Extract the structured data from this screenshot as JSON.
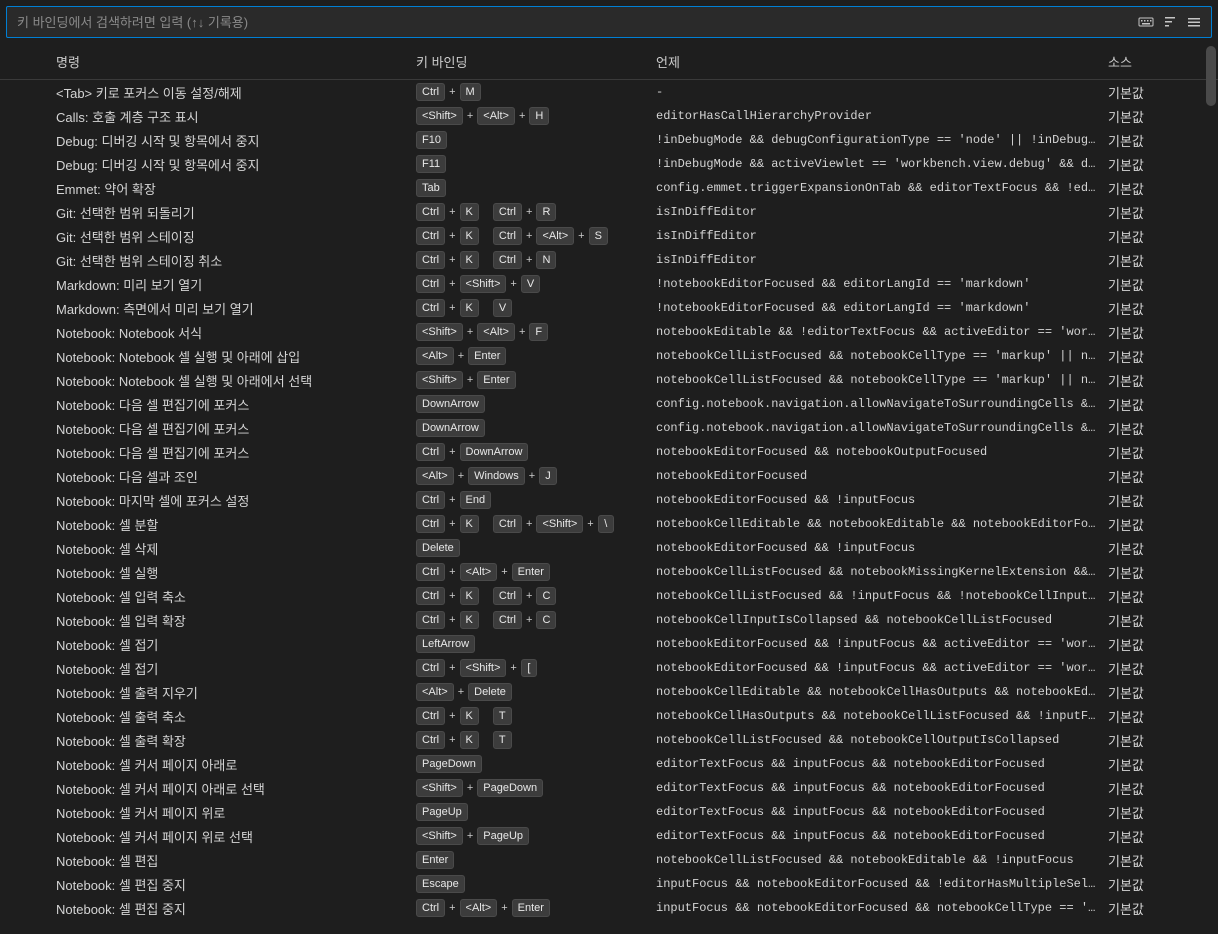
{
  "search": {
    "placeholder": "키 바인딩에서 검색하려면 입력 (↑↓ 기록용)"
  },
  "icons": {
    "keyboard": "keyboard-icon",
    "sort": "sort-icon",
    "filter": "filter-icon"
  },
  "headers": {
    "command": "명령",
    "binding": "키 바인딩",
    "when": "언제",
    "source": "소스"
  },
  "default_source": "기본값",
  "rows": [
    {
      "command": "<Tab> 키로 포커스 이동 설정/해제",
      "keys": [
        [
          "Ctrl",
          "M"
        ]
      ],
      "when": "-",
      "source": "기본값"
    },
    {
      "command": "Calls: 호출 계층 구조 표시",
      "keys": [
        [
          "<Shift>",
          "<Alt>",
          "H"
        ]
      ],
      "when": "editorHasCallHierarchyProvider",
      "source": "기본값"
    },
    {
      "command": "Debug: 디버깅 시작 및 항목에서 중지",
      "keys": [
        [
          "F10"
        ]
      ],
      "when": "!inDebugMode && debugConfigurationType == 'node' || !inDebugMode ...",
      "source": "기본값"
    },
    {
      "command": "Debug: 디버깅 시작 및 항목에서 중지",
      "keys": [
        [
          "F11"
        ]
      ],
      "when": "!inDebugMode && activeViewlet == 'workbench.view.debug' && debugC...",
      "source": "기본값"
    },
    {
      "command": "Emmet: 약어 확장",
      "keys": [
        [
          "Tab"
        ]
      ],
      "when": "config.emmet.triggerExpansionOnTab && editorTextFocus && !editorR...",
      "source": "기본값"
    },
    {
      "command": "Git: 선택한 범위 되돌리기",
      "keys": [
        [
          "Ctrl",
          "K"
        ],
        [
          "Ctrl",
          "R"
        ]
      ],
      "when": "isInDiffEditor",
      "source": "기본값"
    },
    {
      "command": "Git: 선택한 범위 스테이징",
      "keys": [
        [
          "Ctrl",
          "K"
        ],
        [
          "Ctrl",
          "<Alt>",
          "S"
        ]
      ],
      "when": "isInDiffEditor",
      "source": "기본값"
    },
    {
      "command": "Git: 선택한 범위 스테이징 취소",
      "keys": [
        [
          "Ctrl",
          "K"
        ],
        [
          "Ctrl",
          "N"
        ]
      ],
      "when": "isInDiffEditor",
      "source": "기본값"
    },
    {
      "command": "Markdown: 미리 보기 열기",
      "keys": [
        [
          "Ctrl",
          "<Shift>",
          "V"
        ]
      ],
      "when": "!notebookEditorFocused && editorLangId == 'markdown'",
      "source": "기본값"
    },
    {
      "command": "Markdown: 측면에서 미리 보기 열기",
      "keys": [
        [
          "Ctrl",
          "K"
        ],
        [
          "V"
        ]
      ],
      "when": "!notebookEditorFocused && editorLangId == 'markdown'",
      "source": "기본값"
    },
    {
      "command": "Notebook: Notebook 서식",
      "keys": [
        [
          "<Shift>",
          "<Alt>",
          "F"
        ]
      ],
      "when": "notebookEditable && !editorTextFocus && activeEditor == 'workbenc...",
      "source": "기본값"
    },
    {
      "command": "Notebook: Notebook 셀 실행 및 아래에 삽입",
      "keys": [
        [
          "<Alt>",
          "Enter"
        ]
      ],
      "when": "notebookCellListFocused && notebookCellType == 'markup' || notebo...",
      "source": "기본값"
    },
    {
      "command": "Notebook: Notebook 셀 실행 및 아래에서 선택",
      "keys": [
        [
          "<Shift>",
          "Enter"
        ]
      ],
      "when": "notebookCellListFocused && notebookCellType == 'markup' || notebo...",
      "source": "기본값"
    },
    {
      "command": "Notebook: 다음 셀 편집기에 포커스",
      "keys": [
        [
          "DownArrow"
        ]
      ],
      "when": "config.notebook.navigation.allowNavigateToSurroundingCells && edi...",
      "source": "기본값"
    },
    {
      "command": "Notebook: 다음 셀 편집기에 포커스",
      "keys": [
        [
          "DownArrow"
        ]
      ],
      "when": "config.notebook.navigation.allowNavigateToSurroundingCells && not...",
      "source": "기본값"
    },
    {
      "command": "Notebook: 다음 셀 편집기에 포커스",
      "keys": [
        [
          "Ctrl",
          "DownArrow"
        ]
      ],
      "when": "notebookEditorFocused && notebookOutputFocused",
      "source": "기본값"
    },
    {
      "command": "Notebook: 다음 셀과 조인",
      "keys": [
        [
          "<Alt>",
          "Windows",
          "J"
        ]
      ],
      "when": "notebookEditorFocused",
      "source": "기본값"
    },
    {
      "command": "Notebook: 마지막 셀에 포커스 설정",
      "keys": [
        [
          "Ctrl",
          "End"
        ]
      ],
      "when": "notebookEditorFocused && !inputFocus",
      "source": "기본값"
    },
    {
      "command": "Notebook: 셀 분할",
      "keys": [
        [
          "Ctrl",
          "K"
        ],
        [
          "Ctrl",
          "<Shift>",
          "\\"
        ]
      ],
      "when": "notebookCellEditable && notebookEditable && notebookEditorFocused",
      "source": "기본값"
    },
    {
      "command": "Notebook: 셀 삭제",
      "keys": [
        [
          "Delete"
        ]
      ],
      "when": "notebookEditorFocused && !inputFocus",
      "source": "기본값"
    },
    {
      "command": "Notebook: 셀 실행",
      "keys": [
        [
          "Ctrl",
          "<Alt>",
          "Enter"
        ]
      ],
      "when": "notebookCellListFocused && notebookMissingKernelExtension && !not...",
      "source": "기본값"
    },
    {
      "command": "Notebook: 셀 입력 축소",
      "keys": [
        [
          "Ctrl",
          "K"
        ],
        [
          "Ctrl",
          "C"
        ]
      ],
      "when": "notebookCellListFocused && !inputFocus && !notebookCellInputIsCol...",
      "source": "기본값"
    },
    {
      "command": "Notebook: 셀 입력 확장",
      "keys": [
        [
          "Ctrl",
          "K"
        ],
        [
          "Ctrl",
          "C"
        ]
      ],
      "when": "notebookCellInputIsCollapsed && notebookCellListFocused",
      "source": "기본값"
    },
    {
      "command": "Notebook: 셀 접기",
      "keys": [
        [
          "LeftArrow"
        ]
      ],
      "when": "notebookEditorFocused && !inputFocus && activeEditor == 'workbenc...",
      "source": "기본값"
    },
    {
      "command": "Notebook: 셀 접기",
      "keys": [
        [
          "Ctrl",
          "<Shift>",
          "["
        ]
      ],
      "when": "notebookEditorFocused && !inputFocus && activeEditor == 'workbenc...",
      "source": "기본값"
    },
    {
      "command": "Notebook: 셀 출력 지우기",
      "keys": [
        [
          "<Alt>",
          "Delete"
        ]
      ],
      "when": "notebookCellEditable && notebookCellHasOutputs && notebookEditabl...",
      "source": "기본값"
    },
    {
      "command": "Notebook: 셀 출력 축소",
      "keys": [
        [
          "Ctrl",
          "K"
        ],
        [
          "T"
        ]
      ],
      "when": "notebookCellHasOutputs && notebookCellListFocused && !inputFocus ...",
      "source": "기본값"
    },
    {
      "command": "Notebook: 셀 출력 확장",
      "keys": [
        [
          "Ctrl",
          "K"
        ],
        [
          "T"
        ]
      ],
      "when": "notebookCellListFocused && notebookCellOutputIsCollapsed",
      "source": "기본값"
    },
    {
      "command": "Notebook: 셀 커서 페이지 아래로",
      "keys": [
        [
          "PageDown"
        ]
      ],
      "when": "editorTextFocus && inputFocus && notebookEditorFocused",
      "source": "기본값"
    },
    {
      "command": "Notebook: 셀 커서 페이지 아래로 선택",
      "keys": [
        [
          "<Shift>",
          "PageDown"
        ]
      ],
      "when": "editorTextFocus && inputFocus && notebookEditorFocused",
      "source": "기본값"
    },
    {
      "command": "Notebook: 셀 커서 페이지 위로",
      "keys": [
        [
          "PageUp"
        ]
      ],
      "when": "editorTextFocus && inputFocus && notebookEditorFocused",
      "source": "기본값"
    },
    {
      "command": "Notebook: 셀 커서 페이지 위로 선택",
      "keys": [
        [
          "<Shift>",
          "PageUp"
        ]
      ],
      "when": "editorTextFocus && inputFocus && notebookEditorFocused",
      "source": "기본값"
    },
    {
      "command": "Notebook: 셀 편집",
      "keys": [
        [
          "Enter"
        ]
      ],
      "when": "notebookCellListFocused && notebookEditable && !inputFocus",
      "source": "기본값"
    },
    {
      "command": "Notebook: 셀 편집 중지",
      "keys": [
        [
          "Escape"
        ]
      ],
      "when": "inputFocus && notebookEditorFocused && !editorHasMultipleSelectio...",
      "source": "기본값"
    },
    {
      "command": "Notebook: 셀 편집 중지",
      "keys": [
        [
          "Ctrl",
          "<Alt>",
          "Enter"
        ]
      ],
      "when": "inputFocus && notebookEditorFocused && notebookCellType == 'mark...",
      "source": "기본값"
    }
  ]
}
